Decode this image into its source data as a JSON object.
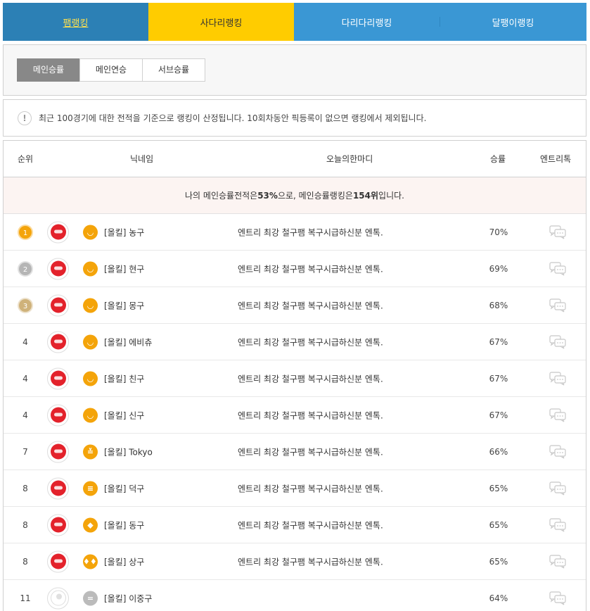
{
  "top_tabs": [
    {
      "label": "팸랭킹"
    },
    {
      "label": "사다리랭킹"
    },
    {
      "label": "다리다리랭킹"
    },
    {
      "label": "달팽이랭킹"
    }
  ],
  "sub_tabs": [
    {
      "label": "메인승률"
    },
    {
      "label": "메인연승"
    },
    {
      "label": "서브승률"
    }
  ],
  "notice": {
    "icon": "!",
    "text": "최근 100경기에 대한 전적을 기준으로 랭킹이 산정됩니다. 10회차동안 픽등록이 없으면 랭킹에서 제외됩니다."
  },
  "table": {
    "headers": {
      "rank": "순위",
      "nickname": "닉네임",
      "message": "오늘의한마디",
      "rate": "승률",
      "entry": "엔트리톡"
    },
    "my_info": {
      "prefix": "나의 메인승률전적은 ",
      "rate": "53%",
      "middle": "으로, 메인승률랭킹은 ",
      "rank": "154위",
      "suffix": " 입니다."
    },
    "rows": [
      {
        "rank": "1",
        "medal": "gold",
        "level_icon": "◡",
        "nickname": "[올킬] 농구",
        "message": "엔트리 최강 철구팸 복구시급하신분 엔톡.",
        "rate": "70%"
      },
      {
        "rank": "2",
        "medal": "silver",
        "level_icon": "◡",
        "nickname": "[올킬] 현구",
        "message": "엔트리 최강 철구팸 복구시급하신분 엔톡.",
        "rate": "69%"
      },
      {
        "rank": "3",
        "medal": "bronze",
        "level_icon": "◡",
        "nickname": "[올킬] 몽구",
        "message": "엔트리 최강 철구팸 복구시급하신분 엔톡.",
        "rate": "68%"
      },
      {
        "rank": "4",
        "medal": "",
        "level_icon": "◡",
        "nickname": "[올킬] 에비츄",
        "message": "엔트리 최강 철구팸 복구시급하신분 엔톡.",
        "rate": "67%"
      },
      {
        "rank": "4",
        "medal": "",
        "level_icon": "◡",
        "nickname": "[올킬] 친구",
        "message": "엔트리 최강 철구팸 복구시급하신분 엔톡.",
        "rate": "67%"
      },
      {
        "rank": "4",
        "medal": "",
        "level_icon": "◡",
        "nickname": "[올킬] 신구",
        "message": "엔트리 최강 철구팸 복구시급하신분 엔톡.",
        "rate": "67%"
      },
      {
        "rank": "7",
        "medal": "",
        "level_icon": "≚",
        "nickname": "[올킬] Tokyo",
        "message": "엔트리 최강 철구팸 복구시급하신분 엔톡.",
        "rate": "66%"
      },
      {
        "rank": "8",
        "medal": "",
        "level_icon": "≡",
        "nickname": "[올킬] 덕구",
        "message": "엔트리 최강 철구팸 복구시급하신분 엔톡.",
        "rate": "65%"
      },
      {
        "rank": "8",
        "medal": "",
        "level_icon": "◆",
        "nickname": "[올킬] 동구",
        "message": "엔트리 최강 철구팸 복구시급하신분 엔톡.",
        "rate": "65%"
      },
      {
        "rank": "8",
        "medal": "",
        "level_icon": "♦♦♦",
        "nickname": "[올킬] 상구",
        "message": "엔트리 최강 철구팸 복구시급하신분 엔톡.",
        "rate": "65%"
      },
      {
        "rank": "11",
        "medal": "",
        "level_icon": "=",
        "nickname": "[올킬] 이중구",
        "message": "",
        "rate": "64%"
      }
    ]
  },
  "colors": {
    "primary_blue": "#3a97d4",
    "active_yellow": "#ffcc00",
    "gold": "#f4a40a",
    "silver": "#b5b5b5",
    "bronze": "#cfb27a",
    "avatar_red": "#e3222b"
  }
}
